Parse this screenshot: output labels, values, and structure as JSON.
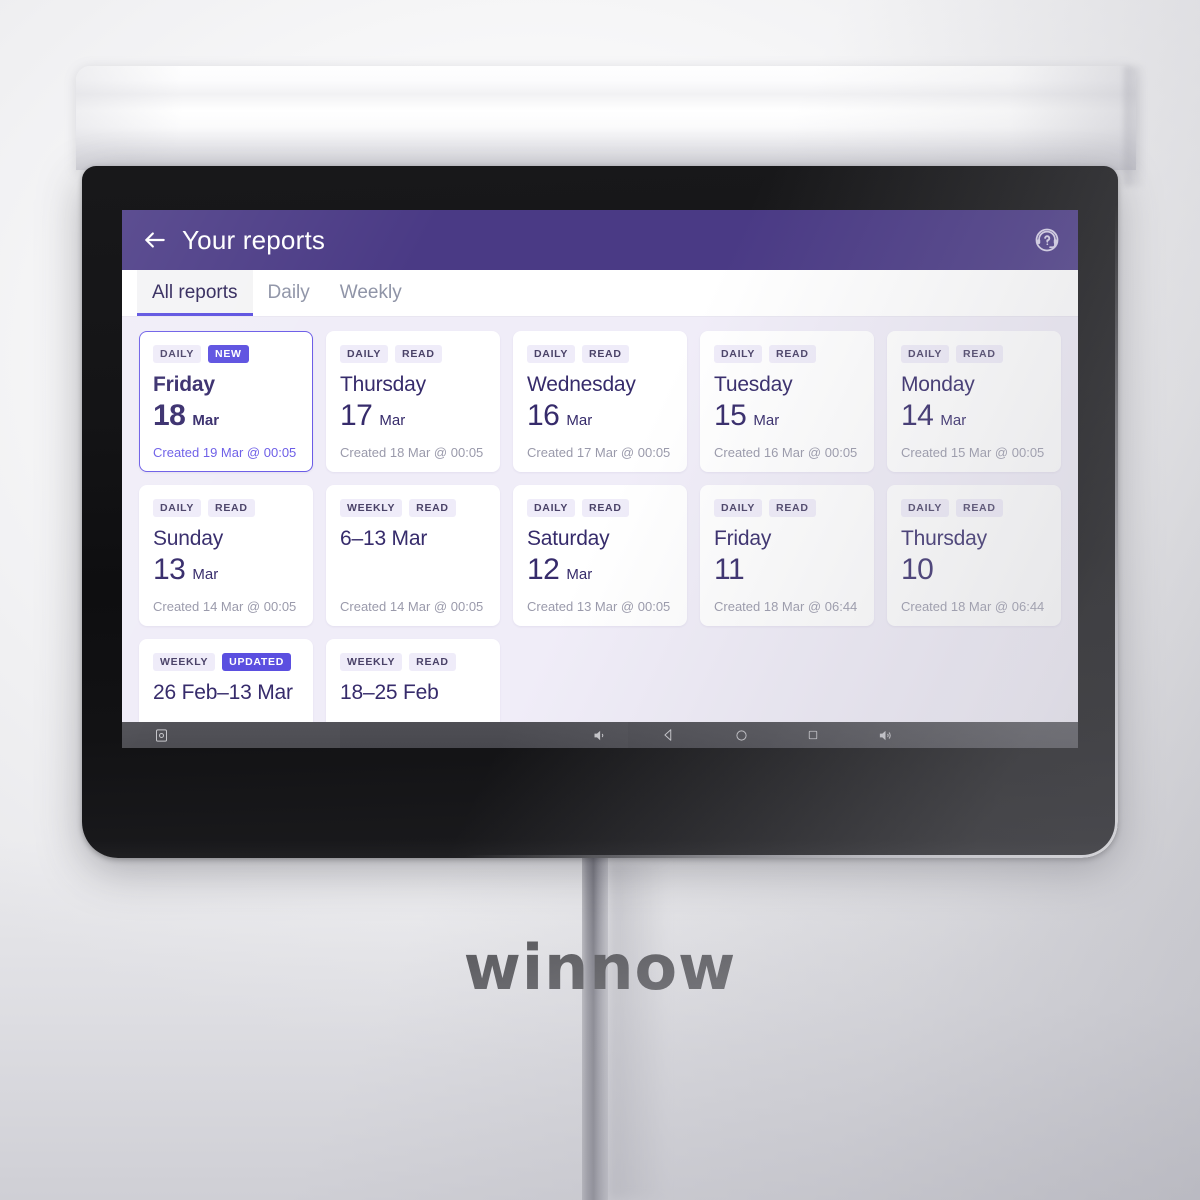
{
  "device": {
    "brand_logo": "winnow",
    "nav_icons": [
      "screenshot-icon",
      "volume-down-icon",
      "back-icon",
      "home-icon",
      "recents-icon",
      "volume-up-icon"
    ]
  },
  "header": {
    "title": "Your reports",
    "back_icon": "back-arrow-icon",
    "help_icon": "support-headset-icon",
    "background_color": "#4A3A85"
  },
  "tabs": {
    "items": [
      {
        "label": "All reports",
        "active": true
      },
      {
        "label": "Daily",
        "active": false
      },
      {
        "label": "Weekly",
        "active": false
      }
    ],
    "active_underline_color": "#5B4FE0"
  },
  "colors": {
    "accent": "#5B4FE0",
    "header_purple": "#4A3A85",
    "title_text": "#362B6B",
    "page_background": "#F0EDF8",
    "badge_background": "#EFECF9",
    "muted_text": "#9A9AAB"
  },
  "reports": [
    {
      "type_badge": "DAILY",
      "status_badge": "NEW",
      "status_accent": true,
      "unread": true,
      "title": "Friday",
      "day": "18",
      "month": "Mar",
      "created": "Created 19 Mar @ 00:05"
    },
    {
      "type_badge": "DAILY",
      "status_badge": "READ",
      "status_accent": false,
      "unread": false,
      "title": "Thursday",
      "day": "17",
      "month": "Mar",
      "created": "Created 18 Mar @ 00:05"
    },
    {
      "type_badge": "DAILY",
      "status_badge": "READ",
      "status_accent": false,
      "unread": false,
      "title": "Wednesday",
      "day": "16",
      "month": "Mar",
      "created": "Created 17 Mar @ 00:05"
    },
    {
      "type_badge": "DAILY",
      "status_badge": "READ",
      "status_accent": false,
      "unread": false,
      "title": "Tuesday",
      "day": "15",
      "month": "Mar",
      "created": "Created 16 Mar @ 00:05"
    },
    {
      "type_badge": "DAILY",
      "status_badge": "READ",
      "status_accent": false,
      "unread": false,
      "title": "Monday",
      "day": "14",
      "month": "Mar",
      "created": "Created 15 Mar @ 00:05"
    },
    {
      "type_badge": "DAILY",
      "status_badge": "READ",
      "status_accent": false,
      "unread": false,
      "title": "Sunday",
      "day": "13",
      "month": "Mar",
      "created": "Created 14 Mar @ 00:05"
    },
    {
      "type_badge": "WEEKLY",
      "status_badge": "READ",
      "status_accent": false,
      "unread": false,
      "title": "6–13 Mar",
      "day": "",
      "month": "",
      "created": "Created 14 Mar @ 00:05"
    },
    {
      "type_badge": "DAILY",
      "status_badge": "READ",
      "status_accent": false,
      "unread": false,
      "title": "Saturday",
      "day": "12",
      "month": "Mar",
      "created": "Created 13 Mar @ 00:05"
    },
    {
      "type_badge": "DAILY",
      "status_badge": "READ",
      "status_accent": false,
      "unread": false,
      "title": "Friday",
      "day": "11",
      "month": "",
      "created": "Created 18 Mar @ 06:44"
    },
    {
      "type_badge": "DAILY",
      "status_badge": "READ",
      "status_accent": false,
      "unread": false,
      "title": "Thursday",
      "day": "10",
      "month": "",
      "created": "Created 18 Mar @ 06:44"
    },
    {
      "type_badge": "WEEKLY",
      "status_badge": "UPDATED",
      "status_accent": true,
      "unread": false,
      "title": "26 Feb–13 Mar",
      "day": "",
      "month": "",
      "created": ""
    },
    {
      "type_badge": "WEEKLY",
      "status_badge": "READ",
      "status_accent": false,
      "unread": false,
      "title": "18–25 Feb",
      "day": "",
      "month": "",
      "created": ""
    }
  ]
}
